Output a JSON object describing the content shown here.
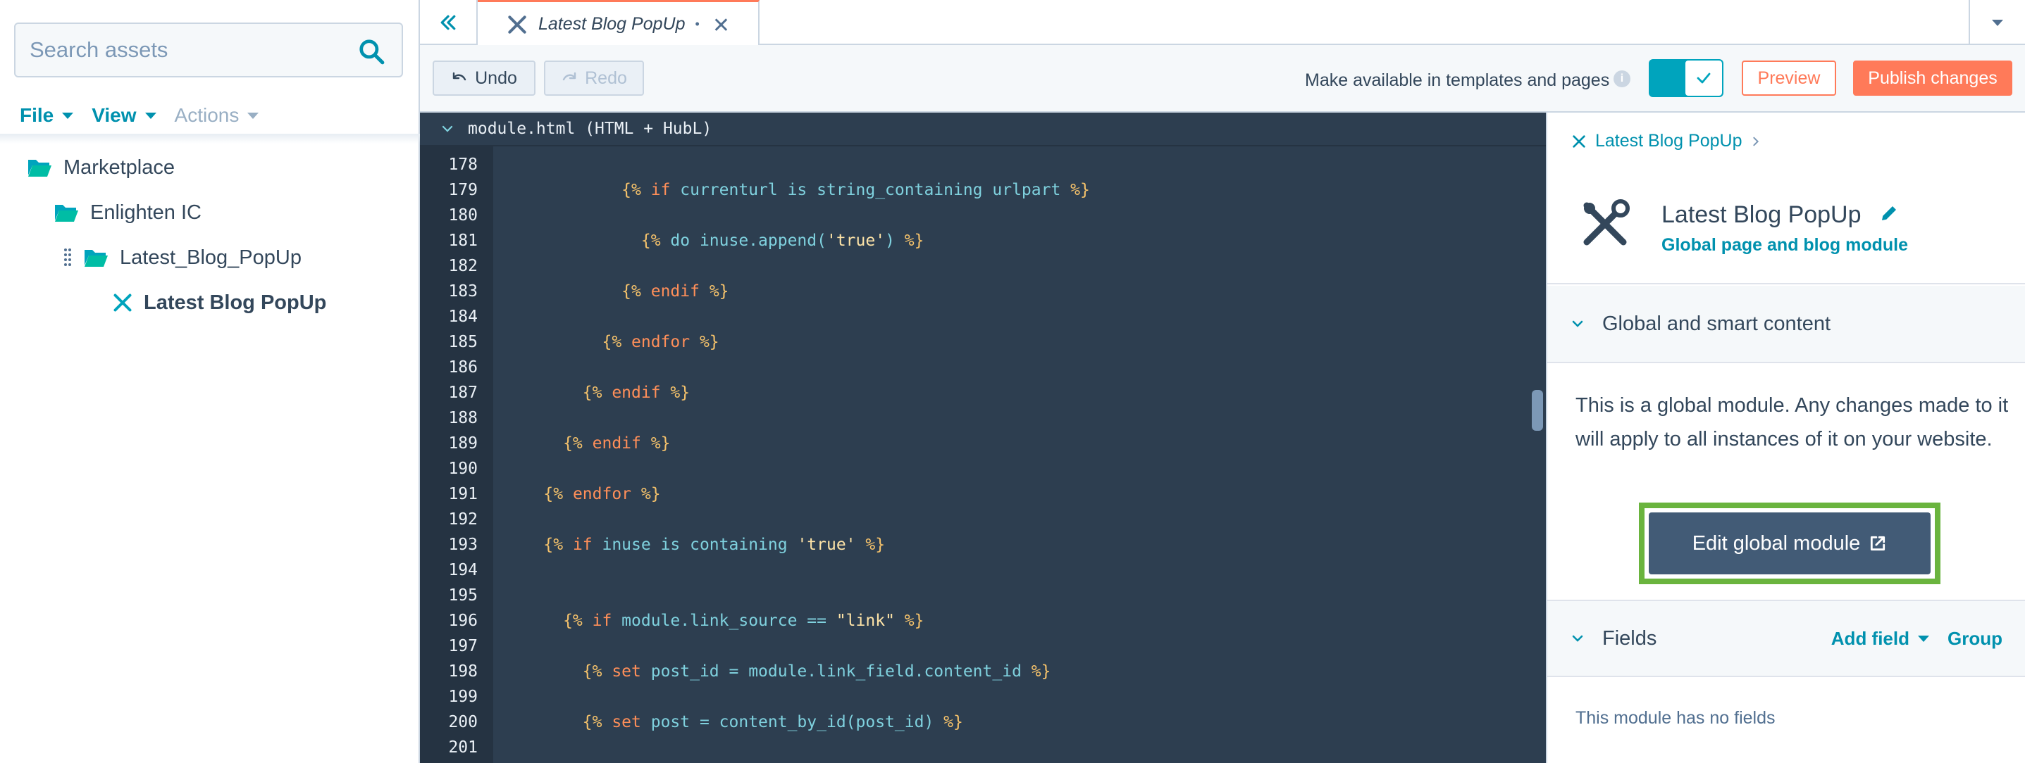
{
  "sidebar": {
    "search": {
      "placeholder": "Search assets",
      "value": ""
    },
    "menu": {
      "file": "File",
      "view": "View",
      "actions": "Actions"
    },
    "tree": [
      {
        "label": "Marketplace"
      },
      {
        "label": "Enlighten IC"
      },
      {
        "label": "Latest_Blog_PopUp"
      },
      {
        "label": "Latest Blog PopUp"
      }
    ]
  },
  "tabs": [
    {
      "label": "Latest Blog PopUp",
      "unsaved_marker": "•",
      "close": "✕"
    }
  ],
  "toolbar": {
    "undo": "Undo",
    "redo": "Redo",
    "availability_label": "Make available in templates and pages",
    "availability_enabled": true,
    "preview": "Preview",
    "publish": "Publish changes"
  },
  "editor": {
    "file_label": "module.html (HTML + HubL)",
    "lines": [
      {
        "n": "178",
        "segs": []
      },
      {
        "n": "179",
        "segs": [
          {
            "t": "            {% ",
            "c": "d"
          },
          {
            "t": "if",
            "c": "k"
          },
          {
            "t": " currenturl is string_containing urlpart ",
            "c": "v"
          },
          {
            "t": "%}",
            "c": "d"
          }
        ]
      },
      {
        "n": "180",
        "segs": []
      },
      {
        "n": "181",
        "segs": [
          {
            "t": "              {% ",
            "c": "d"
          },
          {
            "t": "do inuse.append(",
            "c": "v"
          },
          {
            "t": "'true'",
            "c": "s"
          },
          {
            "t": ") ",
            "c": "v"
          },
          {
            "t": "%}",
            "c": "d"
          }
        ]
      },
      {
        "n": "182",
        "segs": []
      },
      {
        "n": "183",
        "segs": [
          {
            "t": "            {% ",
            "c": "d"
          },
          {
            "t": "endif",
            "c": "k"
          },
          {
            "t": " %}",
            "c": "d"
          }
        ]
      },
      {
        "n": "184",
        "segs": []
      },
      {
        "n": "185",
        "segs": [
          {
            "t": "          {% ",
            "c": "d"
          },
          {
            "t": "endfor",
            "c": "k"
          },
          {
            "t": " %}",
            "c": "d"
          }
        ]
      },
      {
        "n": "186",
        "segs": []
      },
      {
        "n": "187",
        "segs": [
          {
            "t": "        {% ",
            "c": "d"
          },
          {
            "t": "endif",
            "c": "k"
          },
          {
            "t": " %}",
            "c": "d"
          }
        ]
      },
      {
        "n": "188",
        "segs": []
      },
      {
        "n": "189",
        "segs": [
          {
            "t": "      {% ",
            "c": "d"
          },
          {
            "t": "endif",
            "c": "k"
          },
          {
            "t": " %}",
            "c": "d"
          }
        ]
      },
      {
        "n": "190",
        "segs": []
      },
      {
        "n": "191",
        "segs": [
          {
            "t": "    {% ",
            "c": "d"
          },
          {
            "t": "endfor",
            "c": "k"
          },
          {
            "t": " %}",
            "c": "d"
          }
        ]
      },
      {
        "n": "192",
        "segs": []
      },
      {
        "n": "193",
        "segs": [
          {
            "t": "    {% ",
            "c": "d"
          },
          {
            "t": "if",
            "c": "k"
          },
          {
            "t": " inuse is containing ",
            "c": "v"
          },
          {
            "t": "'true'",
            "c": "s"
          },
          {
            "t": " %}",
            "c": "d"
          }
        ]
      },
      {
        "n": "194",
        "segs": []
      },
      {
        "n": "195",
        "segs": []
      },
      {
        "n": "196",
        "segs": [
          {
            "t": "      {% ",
            "c": "d"
          },
          {
            "t": "if",
            "c": "k"
          },
          {
            "t": " module.link_source == ",
            "c": "v"
          },
          {
            "t": "\"link\"",
            "c": "s"
          },
          {
            "t": " %}",
            "c": "d"
          }
        ]
      },
      {
        "n": "197",
        "segs": []
      },
      {
        "n": "198",
        "segs": [
          {
            "t": "        {% ",
            "c": "d"
          },
          {
            "t": "set",
            "c": "k"
          },
          {
            "t": " post_id = module.link_field.content_id ",
            "c": "v"
          },
          {
            "t": "%}",
            "c": "d"
          }
        ]
      },
      {
        "n": "199",
        "segs": []
      },
      {
        "n": "200",
        "segs": [
          {
            "t": "        {% ",
            "c": "d"
          },
          {
            "t": "set",
            "c": "k"
          },
          {
            "t": " post = content_by_id(post_id) ",
            "c": "v"
          },
          {
            "t": "%}",
            "c": "d"
          }
        ]
      },
      {
        "n": "201",
        "segs": []
      }
    ]
  },
  "panel": {
    "breadcrumb": "Latest Blog PopUp",
    "module_title": "Latest Blog PopUp",
    "module_subtitle": "Global page and blog module",
    "global_section_title": "Global and smart content",
    "global_description": "This is a global module. Any changes made to it will apply to all instances of it on your website.",
    "edit_global_button": "Edit global module",
    "fields_section_title": "Fields",
    "add_field": "Add field",
    "group": "Group",
    "no_fields": "This module has no fields"
  },
  "colors": {
    "accent": "#0091ae",
    "publish": "#ff7a59",
    "highlight": "#6ab43e",
    "editor_bg": "#2d3e50"
  }
}
